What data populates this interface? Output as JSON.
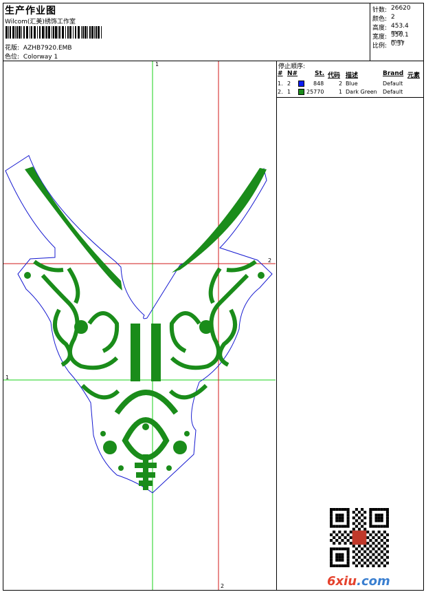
{
  "header": {
    "title": "生产作业图",
    "subtitle": "Wilcom(汇美)绣饰工作室",
    "design_label": "花版:",
    "design_value": "AZHB7920.EMB",
    "colorway_label": "色位:",
    "colorway_value": "Colorway 1"
  },
  "stats": [
    {
      "label": "针数:",
      "value": "26620"
    },
    {
      "label": "颜色:",
      "value": "2"
    },
    {
      "label": "高度:",
      "value": "453.4 mm"
    },
    {
      "label": "宽度:",
      "value": "356.1 mm"
    },
    {
      "label": "比例:",
      "value": "0.37"
    }
  ],
  "stop_sequence": {
    "title": "停止顺序:",
    "columns": [
      "#",
      "N#",
      "St.",
      "代码",
      "描述",
      "Brand",
      "元素"
    ],
    "rows": [
      {
        "idx": "1.",
        "n": "2",
        "stitches": "848",
        "code": "2",
        "desc": "Blue",
        "brand": "Default",
        "color": "#0b1cf2"
      },
      {
        "idx": "2.",
        "n": "1",
        "stitches": "25770",
        "code": "1",
        "desc": "Dark Green",
        "brand": "Default",
        "color": "#1c8c1c"
      }
    ]
  },
  "guides": {
    "v1": "1",
    "h2": "2",
    "h1": "1",
    "v2": "2"
  },
  "colors": {
    "embroidery": "#1a8c1a",
    "outline": "#1418d0",
    "guide_green": "#1ad01a",
    "guide_red": "#d01a1a"
  },
  "watermark": {
    "text_a": "6xiu",
    "text_b": ".com"
  }
}
